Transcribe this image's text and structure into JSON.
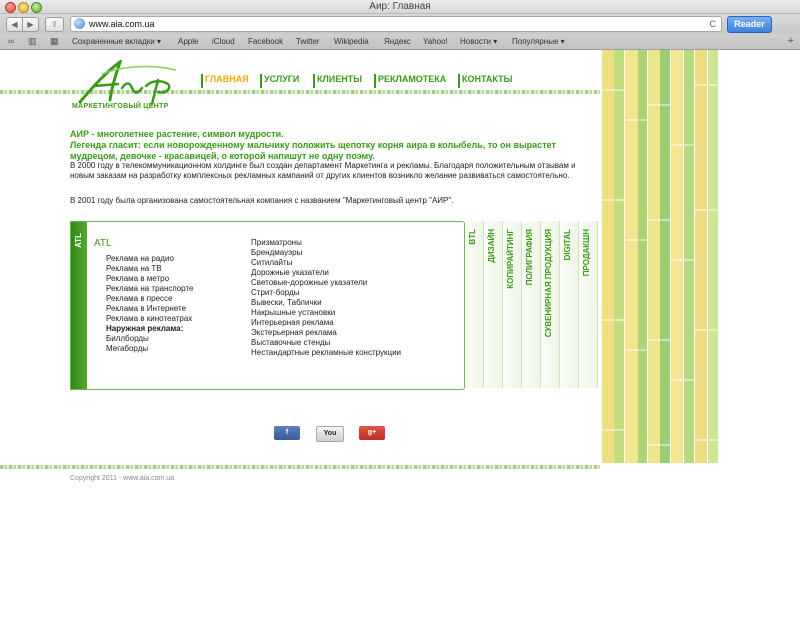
{
  "window": {
    "title": "Аир: Главная"
  },
  "toolbar": {
    "back": "◀",
    "forward": "▶",
    "share": "⇪",
    "url": "www.aia.com.ua",
    "reload": "C",
    "reader": "Reader"
  },
  "bookmarks": {
    "items": [
      "Сохраненные вкладки ▾",
      "Apple",
      "iCloud",
      "Facebook",
      "Twitter",
      "Wikipedia",
      "Яндекс",
      "Yahoo!",
      "Новости ▾",
      "Популярные ▾"
    ],
    "add": "+"
  },
  "site": {
    "logo_text": "МАРКЕТИНГОВЫЙ  ЦЕНТР",
    "nav": [
      "ГЛАВНАЯ",
      "УСЛУГИ",
      "КЛИЕНТЫ",
      "РЕКЛАМОТЕКА",
      "КОНТАКТЫ"
    ],
    "intro": {
      "line1": "АИР - многолетнее растение, символ мудрости.",
      "line2": "Легенда гласит: если новорожденному мальчику положить щепотку корня аира в колыбель, то он вырастет мудрецом, девочке - красавицей, о которой напишут не одну поэму.",
      "para1": "В 2000 году в телекоммуникационном холдинге был создан департамент Маркетинга и рекламы. Благодаря положительным отзывам и новым заказам на разработку комплексных рекламных кампаний от других клиентов возникло желание развиваться самостоятельно.",
      "para2": "В 2001 году  была организована самостоятельная компания с названием \"Маркетинговый центр \"АИР\"."
    },
    "atl": {
      "tab": "ATL",
      "title": "ATL",
      "col1": [
        "Реклама на радио",
        "Реклама на ТВ",
        "Реклама в метро",
        "Реклама на транспорте",
        "Реклама в прессе",
        "Реклама в Интернете",
        "Реклама в кинотеатрах",
        "Наружная реклама:",
        "Биллборды",
        "Мегаборды"
      ],
      "col2": [
        "Призматроны",
        "Брендмауэры",
        "Ситилайты",
        "Дорожные указатели",
        "Световые-дорожные указатели",
        "Стрит-борды",
        "Вывески, Таблички",
        "Накрышные установки",
        "Интерьерная реклама",
        "Экстерьерная реклама",
        "Выставочные стенды",
        "Нестандартные рекламные конструкции"
      ]
    },
    "tabs": [
      "BTL",
      "ДИЗАЙН",
      "КОПИРАЙТИНГ",
      "ПОЛИГРАФИЯ",
      "СУВЕНИРНАЯ ПРОДУКЦИЯ",
      "DIGITAL",
      "ПРОДАКШН"
    ],
    "social": {
      "fb": "f",
      "yt": "You",
      "g": "g+"
    },
    "copyright": "Copyright 2011 - www.aia.com.ua"
  },
  "colors": {
    "brand_green": "#3a9b1a",
    "active_nav": "#f0a800",
    "reader_blue": "#3b7fe0"
  }
}
